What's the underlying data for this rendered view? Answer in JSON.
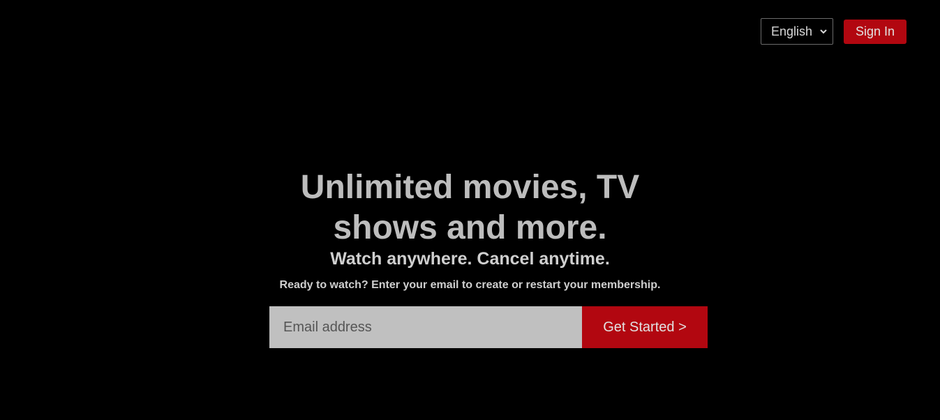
{
  "header": {
    "language": {
      "selected": "English",
      "icon": "chevron-down-icon"
    },
    "signin_label": "Sign In"
  },
  "hero": {
    "title": "Unlimited movies, TV shows and more.",
    "subtitle": "Watch anywhere. Cancel anytime.",
    "cta_text": "Ready to watch? Enter your email to create or restart your membership."
  },
  "form": {
    "email_placeholder": "Email address",
    "email_value": "",
    "submit_label": "Get Started >"
  },
  "colors": {
    "background": "#000000",
    "accent": "#b20710",
    "text": "#bdbdbd",
    "input_bg": "#c0c0c0"
  }
}
